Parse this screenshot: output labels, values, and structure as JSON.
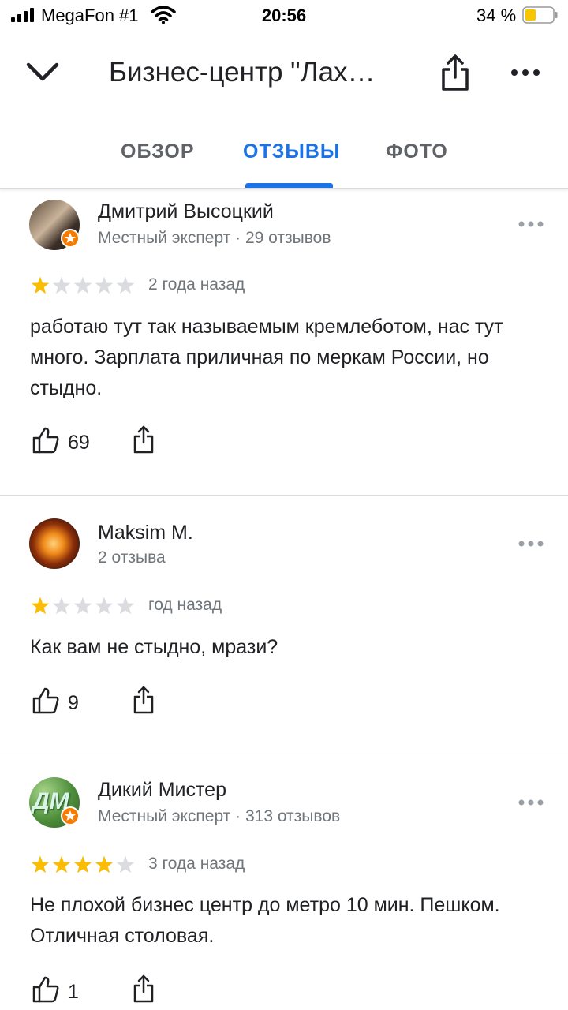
{
  "status_bar": {
    "carrier": "MegaFon #1",
    "time": "20:56",
    "battery": "34 %"
  },
  "header": {
    "title": "Бизнес-центр \"Лах…"
  },
  "tabs": [
    {
      "label": "ОБЗОР",
      "active": false
    },
    {
      "label": "ОТЗЫВЫ",
      "active": true
    },
    {
      "label": "ФОТО",
      "active": false
    }
  ],
  "colors": {
    "accent": "#1a73e8",
    "star": "#fbbc04",
    "star_empty": "#dadce0",
    "badge": "#f57c00"
  },
  "reviews": [
    {
      "author": "Дмитрий Высоцкий",
      "meta": "Местный эксперт · 29 отзывов",
      "rating": 1,
      "date": "2 года назад",
      "text": "работаю тут так называемым кремлеботом, нас тут много. Зарплата приличная по меркам России, но стыдно.",
      "likes": "69",
      "local_expert": true
    },
    {
      "author": "Maksim M.",
      "meta": "2 отзыва",
      "rating": 1,
      "date": "год назад",
      "text": "Как вам не стыдно, мрази?",
      "likes": "9",
      "local_expert": false
    },
    {
      "author": "Дикий Мистер",
      "meta": "Местный эксперт · 313 отзывов",
      "rating": 4,
      "date": "3 года назад",
      "text": "Не плохой бизнес центр до метро 10 мин. Пешком. Отличная столовая.",
      "likes": "1",
      "local_expert": true,
      "avatar_initials": "ДМ"
    }
  ]
}
